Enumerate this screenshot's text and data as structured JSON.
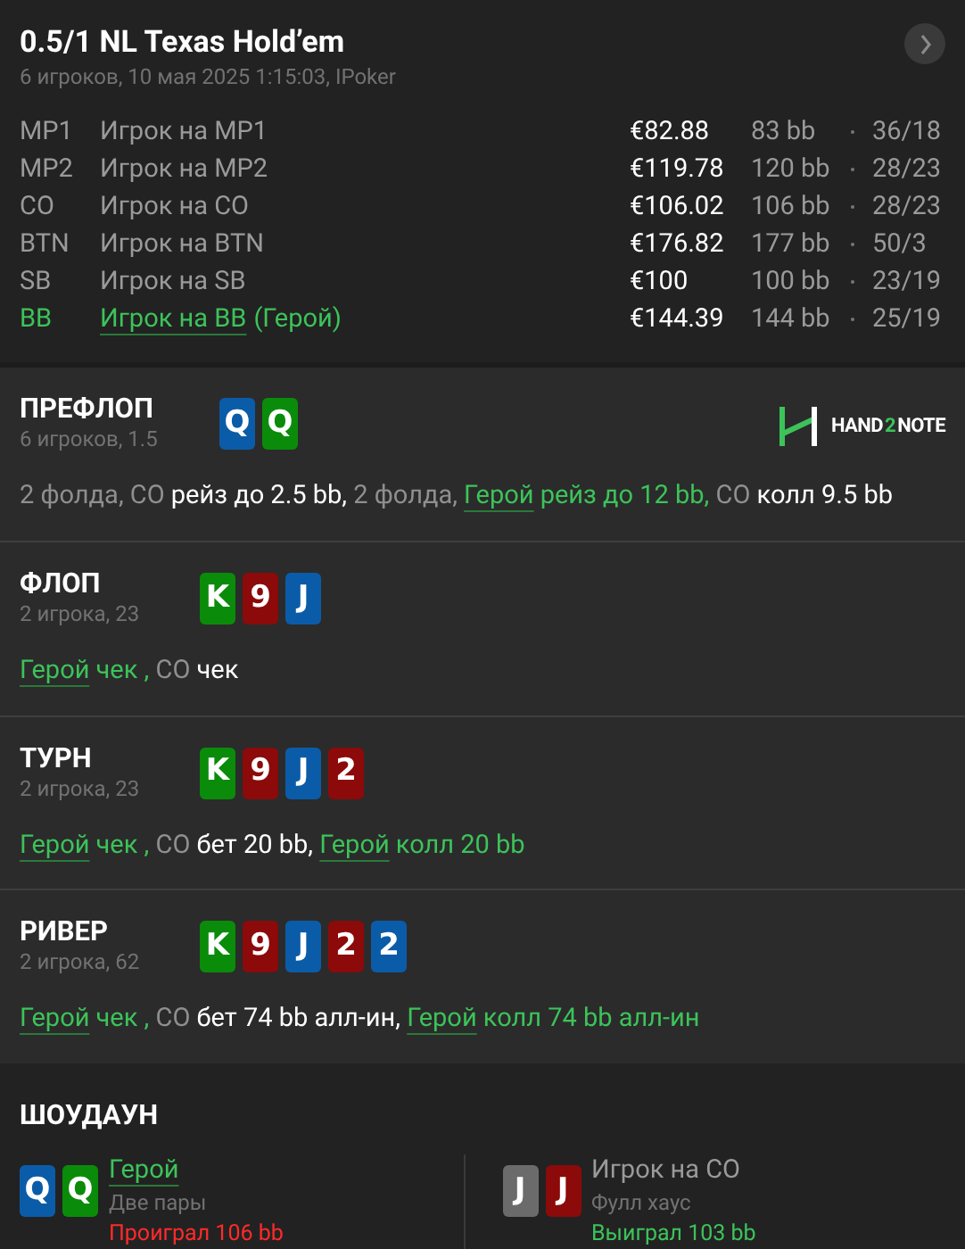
{
  "header": {
    "title": "0.5/1 NL Texas Hold’em",
    "subtitle": "6 игроков, 10 мая 2025 1:15:03, IPoker"
  },
  "players": [
    {
      "position": "MP1",
      "name": "Игрок на MP1",
      "hero": false,
      "stack": "€82.88",
      "bb": "83 bb",
      "stats": "36/18"
    },
    {
      "position": "MP2",
      "name": "Игрок на MP2",
      "hero": false,
      "stack": "€119.78",
      "bb": "120 bb",
      "stats": "28/23"
    },
    {
      "position": "CO",
      "name": "Игрок на CO",
      "hero": false,
      "stack": "€106.02",
      "bb": "106 bb",
      "stats": "28/23"
    },
    {
      "position": "BTN",
      "name": "Игрок на BTN",
      "hero": false,
      "stack": "€176.82",
      "bb": "177 bb",
      "stats": "50/3"
    },
    {
      "position": "SB",
      "name": "Игрок на SB",
      "hero": false,
      "stack": "€100",
      "bb": "100 bb",
      "stats": "23/19"
    },
    {
      "position": "BB",
      "name": "Игрок на BB",
      "hero": true,
      "hero_tag": "(Герой)",
      "stack": "€144.39",
      "bb": "144 bb",
      "stats": "25/19"
    }
  ],
  "streets": [
    {
      "name": "ПРЕФЛОП",
      "info": "6 игроков, 1.5",
      "logo": {
        "parts": [
          "HAND",
          "2",
          "NOTE"
        ]
      },
      "cards": [
        {
          "rank": "Q",
          "color": "#0b5ca8"
        },
        {
          "rank": "Q",
          "color": "#0a8c0a"
        }
      ],
      "actions": [
        {
          "kind": "plain",
          "text": "2 фолда, CO "
        },
        {
          "kind": "action",
          "text": "рейз до 2.5 bb,"
        },
        {
          "kind": "plain",
          "text": " 2 фолда, "
        },
        {
          "kind": "hero_link",
          "text": "Герой"
        },
        {
          "kind": "hero",
          "text": " рейз до 12 bb,"
        },
        {
          "kind": "plain",
          "text": " CO "
        },
        {
          "kind": "action",
          "text": "колл 9.5 bb"
        }
      ]
    },
    {
      "name": "ФЛОП",
      "info": "2 игрока, 23",
      "cards": [
        {
          "rank": "K",
          "color": "#0a8c0a"
        },
        {
          "rank": "9",
          "color": "#8c0a0a"
        },
        {
          "rank": "J",
          "color": "#0b5ca8"
        }
      ],
      "actions": [
        {
          "kind": "hero_link",
          "text": "Герой"
        },
        {
          "kind": "hero",
          "text": " чек ,"
        },
        {
          "kind": "plain",
          "text": " CO "
        },
        {
          "kind": "action",
          "text": "чек"
        }
      ]
    },
    {
      "name": "ТУРН",
      "info": "2 игрока, 23",
      "cards": [
        {
          "rank": "K",
          "color": "#0a8c0a"
        },
        {
          "rank": "9",
          "color": "#8c0a0a"
        },
        {
          "rank": "J",
          "color": "#0b5ca8"
        },
        {
          "rank": "2",
          "color": "#8c0a0a"
        }
      ],
      "actions": [
        {
          "kind": "hero_link",
          "text": "Герой"
        },
        {
          "kind": "hero",
          "text": " чек ,"
        },
        {
          "kind": "plain",
          "text": " CO "
        },
        {
          "kind": "action",
          "text": "бет 20 bb, "
        },
        {
          "kind": "hero_link",
          "text": "Герой"
        },
        {
          "kind": "hero",
          "text": " колл 20 bb"
        }
      ]
    },
    {
      "name": "РИВЕР",
      "info": "2 игрока, 62",
      "cards": [
        {
          "rank": "K",
          "color": "#0a8c0a"
        },
        {
          "rank": "9",
          "color": "#8c0a0a"
        },
        {
          "rank": "J",
          "color": "#0b5ca8"
        },
        {
          "rank": "2",
          "color": "#8c0a0a"
        },
        {
          "rank": "2",
          "color": "#0b5ca8"
        }
      ],
      "actions": [
        {
          "kind": "hero_link",
          "text": "Герой"
        },
        {
          "kind": "hero",
          "text": " чек ,"
        },
        {
          "kind": "plain",
          "text": " CO "
        },
        {
          "kind": "action",
          "text": "бет 74 bb алл-ин, "
        },
        {
          "kind": "hero_link",
          "text": "Герой"
        },
        {
          "kind": "hero",
          "text": " колл 74 bb алл-ин"
        }
      ]
    }
  ],
  "showdown": {
    "title": "ШОУДАУН",
    "hands": [
      {
        "name": "Герой",
        "hero": true,
        "cards": [
          {
            "rank": "Q",
            "color": "#0b5ca8"
          },
          {
            "rank": "Q",
            "color": "#0a8c0a"
          }
        ],
        "hand": "Две пары",
        "result": "Проиграл 106 bb",
        "won": false
      },
      {
        "name": "Игрок на CO",
        "hero": false,
        "cards": [
          {
            "rank": "J",
            "color": "#6b6b6b"
          },
          {
            "rank": "J",
            "color": "#8c0a0a"
          }
        ],
        "hand": "Фулл хаус",
        "result": "Выиграл 103 bb",
        "won": true
      }
    ]
  }
}
